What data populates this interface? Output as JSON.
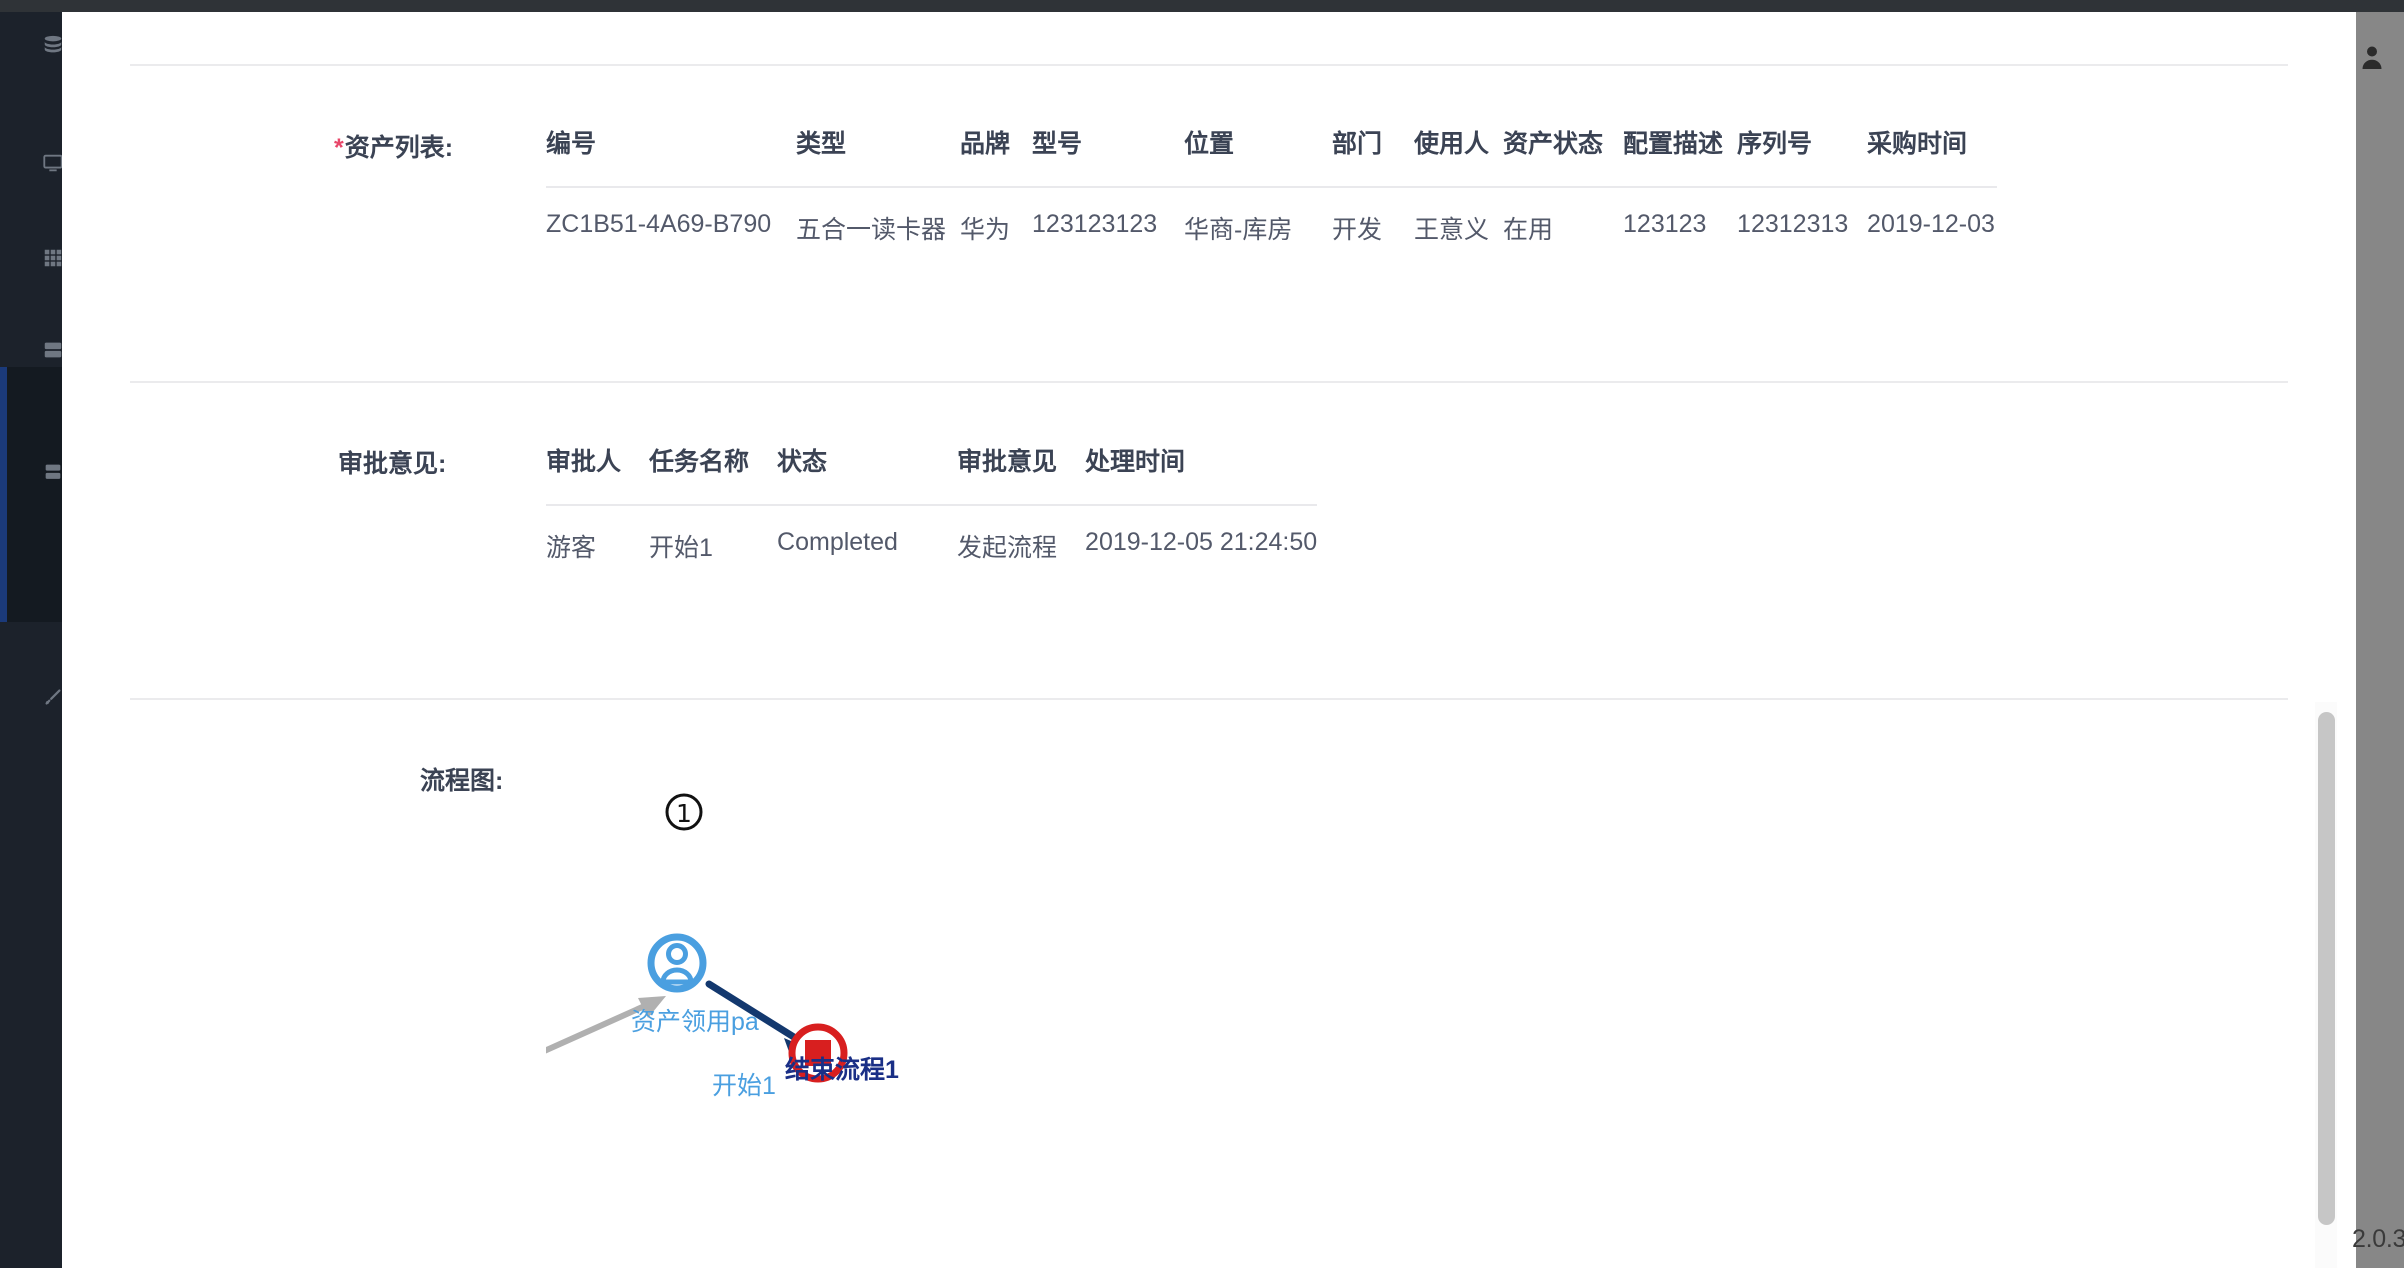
{
  "window": {
    "app_version": "2.0.3"
  },
  "sidebar": {
    "items": [
      {
        "name": "database-icon",
        "icon": "database"
      },
      {
        "name": "monitor-icon",
        "icon": "monitor"
      },
      {
        "name": "grid-icon",
        "icon": "grid"
      },
      {
        "name": "server-icon",
        "icon": "server"
      },
      {
        "name": "layers-icon",
        "icon": "layers"
      },
      {
        "name": "wrench-icon",
        "icon": "wrench"
      }
    ]
  },
  "modal": {
    "asset_section": {
      "label": "资产列表:",
      "required": true,
      "required_marker": "*",
      "columns": [
        "编号",
        "类型",
        "品牌",
        "型号",
        "位置",
        "部门",
        "使用人",
        "资产状态",
        "配置描述",
        "序列号",
        "采购时间"
      ],
      "rows": [
        [
          "ZC1B51-4A69-B790",
          "五合一读卡器",
          "华为",
          "123123123",
          "华商-库房",
          "开发",
          "王意义",
          "在用",
          "123123",
          "12312313",
          "2019-12-03"
        ]
      ]
    },
    "approval_section": {
      "label": "审批意见:",
      "columns": [
        "审批人",
        "任务名称",
        "状态",
        "审批意见",
        "处理时间"
      ],
      "rows": [
        [
          "游客",
          "开始1",
          "Completed",
          "发起流程",
          "2019-12-05 21:24:50"
        ]
      ]
    },
    "flow_section": {
      "label": "流程图:",
      "nodes": [
        {
          "id": "start",
          "name": "start-event-node",
          "label": "开始1",
          "type": "start-event",
          "badge": "①",
          "color": "#4a9fe0"
        },
        {
          "id": "task",
          "name": "user-task-node",
          "label": "资产领用pa",
          "type": "user-task",
          "badge": "①",
          "color": "#4a9fe0"
        },
        {
          "id": "end",
          "name": "end-event-node",
          "label": "结束流程1",
          "type": "end-event",
          "badge": "",
          "color": "#d81f1f"
        }
      ],
      "edges": [
        {
          "from": "start",
          "to": "task",
          "state": "completed",
          "color": "#b0b0b0"
        },
        {
          "from": "task",
          "to": "end",
          "state": "active",
          "color": "#13386e"
        }
      ]
    }
  }
}
